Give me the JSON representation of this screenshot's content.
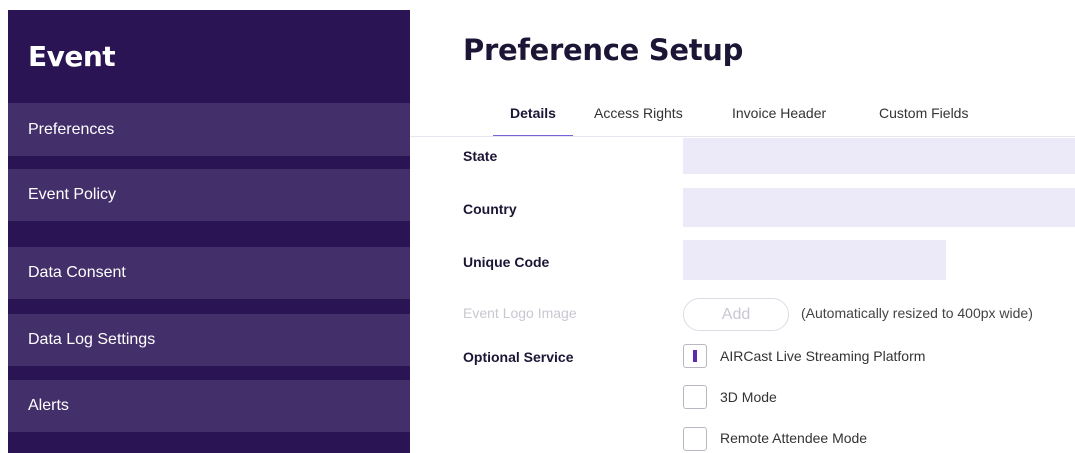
{
  "sidebar": {
    "title": "Event",
    "items": [
      {
        "label": "Preferences"
      },
      {
        "label": "Event Policy"
      },
      {
        "label": "Data Consent"
      },
      {
        "label": "Data Log Settings"
      },
      {
        "label": "Alerts"
      }
    ]
  },
  "main": {
    "title": "Preference Setup",
    "tabs": [
      {
        "label": "Details",
        "active": true
      },
      {
        "label": "Access Rights",
        "active": false
      },
      {
        "label": "Invoice Header",
        "active": false
      },
      {
        "label": "Custom Fields",
        "active": false
      }
    ],
    "fields": {
      "state": {
        "label": "State",
        "value": ""
      },
      "country": {
        "label": "Country",
        "value": ""
      },
      "unique_code": {
        "label": "Unique Code",
        "value": ""
      },
      "event_logo": {
        "label": "Event Logo Image",
        "button_label": "Add",
        "note": "(Automatically resized to 400px wide)"
      },
      "optional_service": {
        "label": "Optional Service",
        "options": [
          {
            "label": "AIRCast Live Streaming Platform",
            "checked": true
          },
          {
            "label": "3D Mode",
            "checked": false
          },
          {
            "label": "Remote Attendee Mode",
            "checked": false
          }
        ]
      }
    }
  },
  "colors": {
    "sidebar_bg": "#2a1454",
    "sidebar_item_bg": "#43306b",
    "input_bg": "#eceaf8",
    "accent": "#7b61d6",
    "check_mark": "#5b2ab0"
  }
}
